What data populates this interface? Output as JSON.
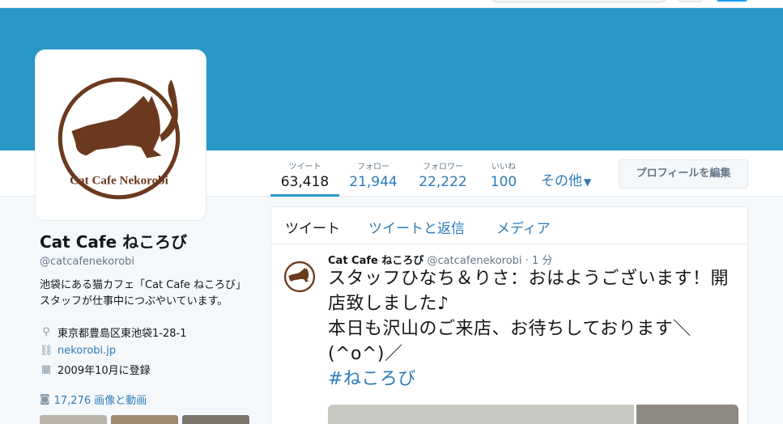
{
  "banner_color": "#2898c7",
  "accent_color": "#2b7bb9",
  "profile": {
    "name": "Cat Cafe ねころび",
    "handle": "@catcafenekorobi",
    "bio": "池袋にある猫カフェ「Cat Cafe ねころび」スタッフが仕事中につぶやいています。",
    "location": "東京都豊島区東池袋1-28-1",
    "website": "nekorobi.jp",
    "joined": "2009年10月に登録",
    "media_count": "17,276 画像と動画",
    "avatar_text": "Cat Cafe Nekorobi"
  },
  "stats": [
    {
      "label": "ツイート",
      "value": "63,418"
    },
    {
      "label": "フォロー",
      "value": "21,944"
    },
    {
      "label": "フォロワー",
      "value": "22,222"
    },
    {
      "label": "いいね",
      "value": "100"
    }
  ],
  "more_label": "その他",
  "edit_profile_label": "プロフィールを編集",
  "tabs": [
    "ツイート",
    "ツイートと返信",
    "メディア"
  ],
  "tweet": {
    "name": "Cat Cafe ねころび",
    "handle": "@catcafenekorobi",
    "time": "· 1 分",
    "text": "スタッフひなち＆りさ：おはようございます！開店致しました♪\n本日も沢山のご来店、お待ちしております＼(^o^)／",
    "hashtag": "#ねころび"
  },
  "icons": {
    "location": "map-pin-icon",
    "link": "link-icon",
    "calendar": "calendar-icon",
    "camera": "camera-icon",
    "chevron": "chevron-down-icon"
  }
}
